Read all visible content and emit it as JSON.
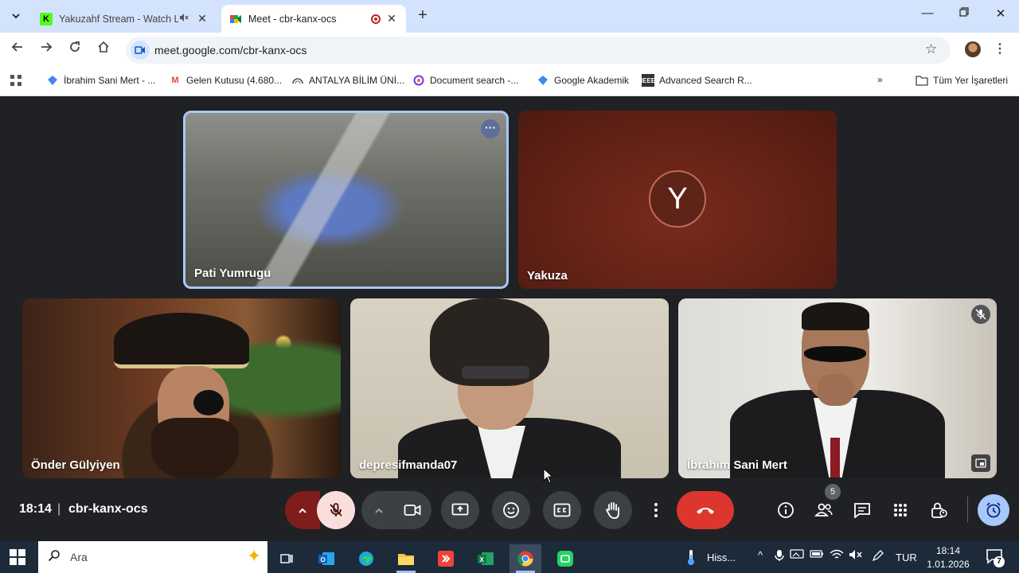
{
  "browser": {
    "tabs": [
      {
        "title": "Yakuzahf Stream - Watch Li",
        "favicon": "kick-icon",
        "state": "inactive",
        "muted": true
      },
      {
        "title": "Meet - cbr-kanx-ocs",
        "favicon": "meet-icon",
        "state": "active",
        "recording": true
      }
    ],
    "url": "meet.google.com/cbr-kanx-ocs",
    "bookmarks": [
      {
        "label": "İbrahim Sani Mert - ...",
        "icon": "scholar-icon"
      },
      {
        "label": "Gelen Kutusu (4.680...",
        "icon": "gmail-icon"
      },
      {
        "label": "ANTALYA BİLİM ÜNİ...",
        "icon": "university-icon"
      },
      {
        "label": "Document search -...",
        "icon": "document-search-icon"
      },
      {
        "label": "Google Akademik",
        "icon": "scholar-icon"
      },
      {
        "label": "Advanced Search R...",
        "icon": "ieee-icon"
      }
    ],
    "all_bookmarks_label": "Tüm Yer İşaretleri"
  },
  "meet": {
    "participants": [
      {
        "name": "Pati Yumrugu",
        "video": true,
        "highlighted": true
      },
      {
        "name": "Yakuza",
        "video": false,
        "avatar_letter": "Y"
      },
      {
        "name": "Önder Gülyiyen",
        "video": true
      },
      {
        "name": "depresifmanda07",
        "video": true
      },
      {
        "name": "İbrahim Sani Mert",
        "video": true,
        "muted": true
      }
    ],
    "time": "18:14",
    "separator": "|",
    "meeting_code": "cbr-kanx-ocs",
    "people_count": "5"
  },
  "taskbar": {
    "search_placeholder": "Ara",
    "weather_label": "Hiss...",
    "language": "TUR",
    "time": "18:14",
    "date": "1.01.2026",
    "notification_count": "7"
  },
  "colors": {
    "tabstrip": "#d3e3fd",
    "meet_background": "#202124",
    "hangup": "#dc362e",
    "mic_off_bg": "#f9dedc",
    "highlight_border": "#a8c7fa",
    "taskbar": "#1c2a3a"
  }
}
